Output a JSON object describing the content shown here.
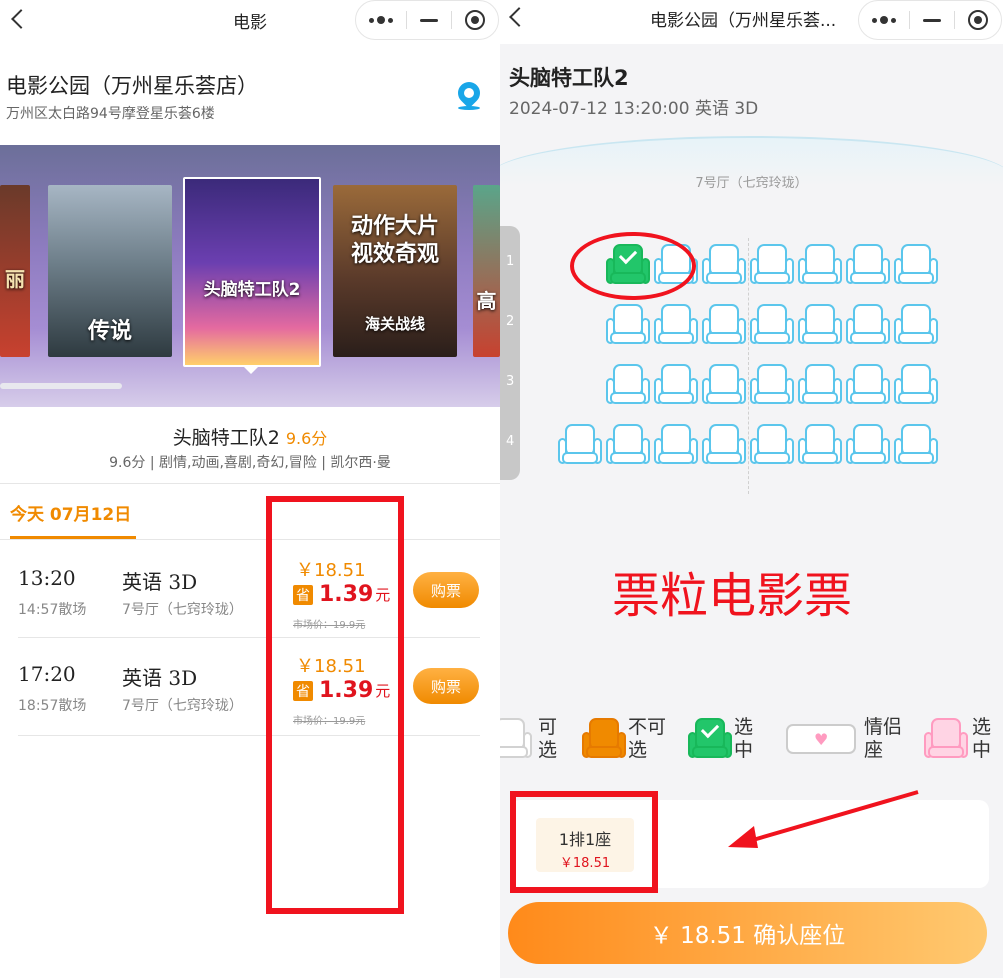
{
  "left": {
    "nav_title": "电影",
    "cinema": {
      "name": "电影公园（万州星乐荟店）",
      "address": "万州区太白路94号摩登星乐荟6楼"
    },
    "posters": [
      {
        "title": "丽"
      },
      {
        "title": "传说"
      },
      {
        "title": "头脑特工队2"
      },
      {
        "title": "动作大片视效奇观",
        "sub": "海关战线"
      },
      {
        "title": "高"
      }
    ],
    "movie": {
      "title": "头脑特工队2",
      "score": "9.6分",
      "meta": "9.6分 | 剧情,动画,喜剧,奇幻,冒险 | 凯尔西·曼"
    },
    "date_tab": "今天 07月12日",
    "showtimes": [
      {
        "time": "13:20",
        "end": "14:57散场",
        "lang": "英语 3D",
        "hall": "7号厅（七窍玲珑）",
        "price": "￥18.51",
        "save_tag": "省",
        "save_amount": "1.39",
        "save_unit": "元",
        "market": "市场价：19.9元",
        "buy": "购票"
      },
      {
        "time": "17:20",
        "end": "18:57散场",
        "lang": "英语 3D",
        "hall": "7号厅（七窍玲珑）",
        "price": "￥18.51",
        "save_tag": "省",
        "save_amount": "1.39",
        "save_unit": "元",
        "market": "市场价：19.9元",
        "buy": "购票"
      }
    ]
  },
  "right": {
    "nav_title": "电影公园（万州星乐荟...",
    "movie_title": "头脑特工队2",
    "session": "2024-07-12 13:20:00 英语 3D",
    "hall": "7号厅（七窍玲珑）",
    "row_labels": [
      "1",
      "2",
      "3",
      "4"
    ],
    "seat_rows": [
      {
        "row": "1",
        "seats": [
          "selected",
          "available",
          "available",
          "available",
          "available",
          "available",
          "available"
        ]
      },
      {
        "row": "2",
        "seats": [
          "available",
          "available",
          "available",
          "available",
          "available",
          "available",
          "available"
        ]
      },
      {
        "row": "3",
        "seats": [
          "available",
          "available",
          "available",
          "available",
          "available",
          "available",
          "available"
        ]
      },
      {
        "row": "4",
        "seats": [
          "available",
          "available",
          "available",
          "available",
          "available",
          "available",
          "available",
          "available"
        ]
      }
    ],
    "watermark": "票粒电影票",
    "legend": [
      {
        "line1": "可",
        "line2": "选"
      },
      {
        "line1": "不可",
        "line2": "选"
      },
      {
        "line1": "选",
        "line2": "中"
      },
      {
        "line1": "情侣",
        "line2": "座"
      },
      {
        "line1": "选",
        "line2": "中"
      }
    ],
    "selected": {
      "seat": "1排1座",
      "price": "￥18.51"
    },
    "confirm": "￥ 18.51 确认座位"
  }
}
